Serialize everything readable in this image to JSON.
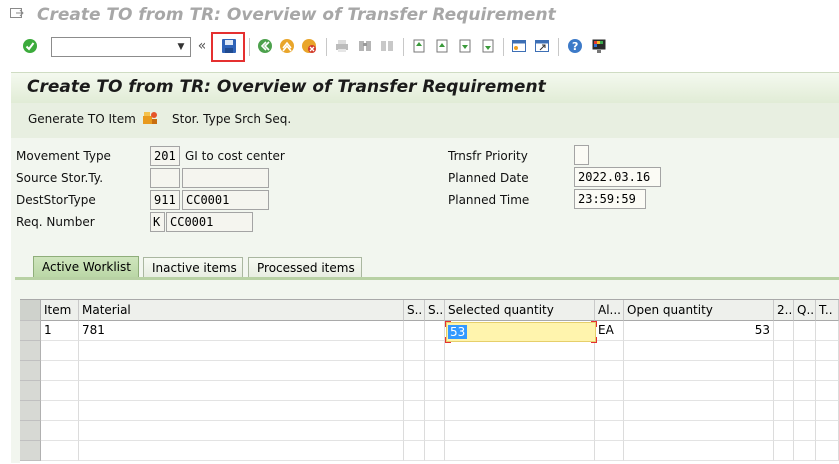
{
  "window": {
    "title": "Create TO from TR: Overview of Transfer Requirement"
  },
  "toolbar": {
    "command_value": ""
  },
  "screen": {
    "title": "Create TO from TR: Overview of Transfer Requirement"
  },
  "app_toolbar": {
    "generate": "Generate TO Item",
    "stor_type": "Stor. Type Srch Seq."
  },
  "header": {
    "movement_type_label": "Movement Type",
    "movement_type": "201",
    "movement_text": "GI to cost center",
    "source_label": "Source Stor.Ty.",
    "source_value": "",
    "source_text": "",
    "dest_label": "DestStorType",
    "dest_value": "911",
    "dest_text": "CC0001",
    "req_label": "Req. Number",
    "req_type": "K",
    "req_value": "CC0001",
    "priority_label": "Trnsfr Priority",
    "priority_value": "",
    "planned_date_label": "Planned Date",
    "planned_date": "2022.03.16",
    "planned_time_label": "Planned Time",
    "planned_time": "23:59:59"
  },
  "tabs": [
    "Active Worklist",
    "Inactive items",
    "Processed items"
  ],
  "table": {
    "columns": [
      "Item",
      "Material",
      "S..",
      "S..",
      "Selected quantity",
      "Al...",
      "Open quantity",
      "2..",
      "Q..",
      "T.."
    ],
    "rows": [
      {
        "item": "1",
        "material": "781",
        "selected_qty": "53",
        "unit": "EA",
        "open_qty": "53"
      }
    ]
  }
}
